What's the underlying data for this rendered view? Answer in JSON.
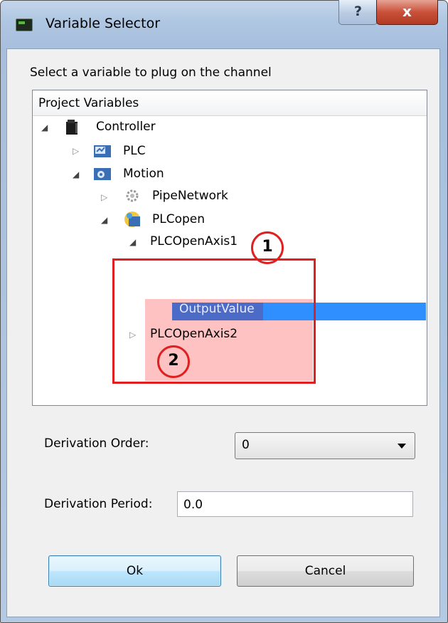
{
  "window": {
    "title": "Variable Selector",
    "help_label": "?",
    "close_label": "x"
  },
  "instruction": "Select a variable to plug on the channel",
  "tree": {
    "header": "Project Variables",
    "nodes": [
      {
        "label": "Controller",
        "expanded": true
      },
      {
        "label": "PLC",
        "expanded": false
      },
      {
        "label": "Motion",
        "expanded": true
      },
      {
        "label": "PipeNetwork",
        "expanded": false
      },
      {
        "label": "PLCopen",
        "expanded": true
      },
      {
        "label": "PLCOpenAxis1",
        "expanded": true
      },
      {
        "label": "OutputValue",
        "selected": true
      },
      {
        "label": "PLCOpenAxis2",
        "expanded": false
      }
    ]
  },
  "annotations": {
    "callout1": "1",
    "callout2": "2",
    "color": "#e02020"
  },
  "derivation_order": {
    "label": "Derivation Order:",
    "value": "0"
  },
  "derivation_period": {
    "label": "Derivation Period:",
    "value": "0.0"
  },
  "buttons": {
    "ok": "Ok",
    "cancel": "Cancel"
  },
  "colors": {
    "selection": "#2f8fff",
    "selection_label": "#4b6bc7",
    "highlight_pink": "rgba(255,80,80,0.35)"
  }
}
